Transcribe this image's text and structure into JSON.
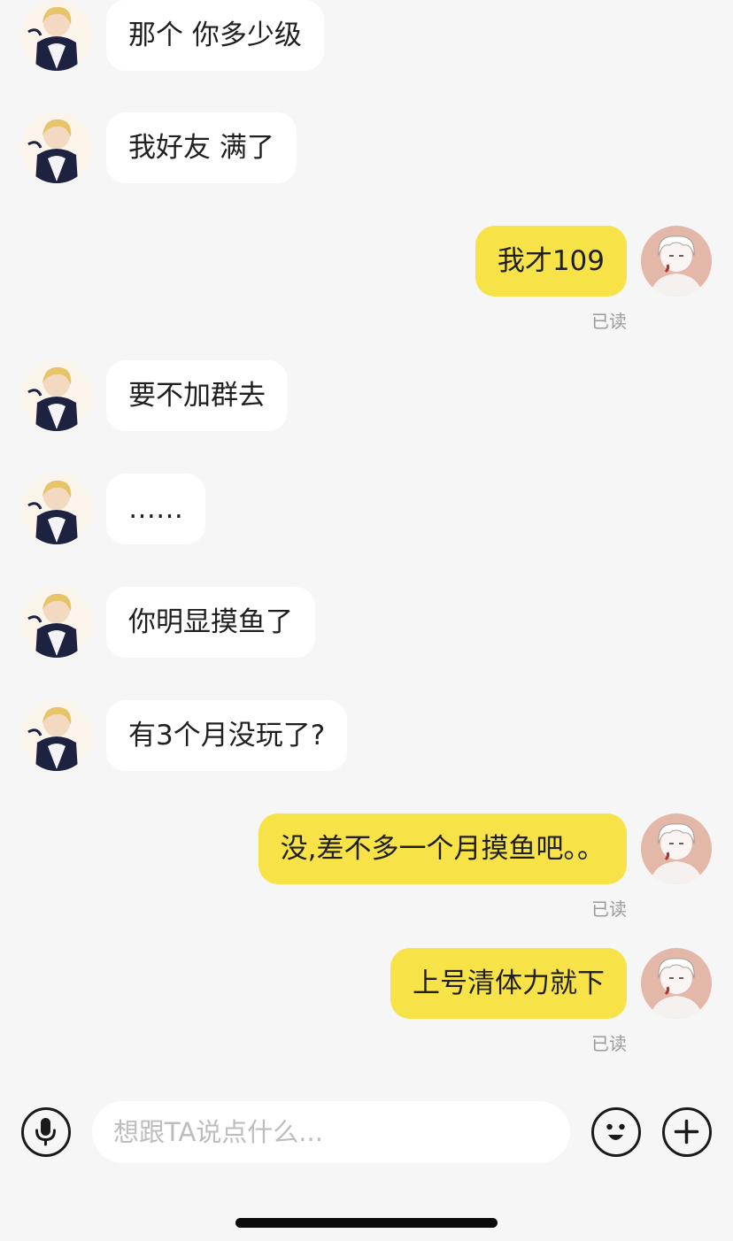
{
  "messages": [
    {
      "side": "left",
      "text": "那个  你多少级",
      "read": ""
    },
    {
      "side": "left",
      "text": "我好友 满了",
      "read": ""
    },
    {
      "side": "right",
      "text": "我才109",
      "read": "已读"
    },
    {
      "side": "left",
      "text": "要不加群去",
      "read": ""
    },
    {
      "side": "left",
      "text": "……",
      "read": ""
    },
    {
      "side": "left",
      "text": "你明显摸鱼了",
      "read": ""
    },
    {
      "side": "left",
      "text": "有3个月没玩了?",
      "read": ""
    },
    {
      "side": "right",
      "text": "没,差不多一个月摸鱼吧。。",
      "read": "已读"
    },
    {
      "side": "right",
      "text": "上号清体力就下",
      "read": "已读"
    }
  ],
  "input": {
    "placeholder": "想跟TA说点什么..."
  },
  "icons": {
    "voice": "microphone-icon",
    "emoji": "smiley-icon",
    "more": "plus-icon"
  },
  "colors": {
    "background": "#f6f6f6",
    "incoming_bubble": "#ffffff",
    "outgoing_bubble": "#f7e348",
    "read_label": "#9a9a9a"
  }
}
